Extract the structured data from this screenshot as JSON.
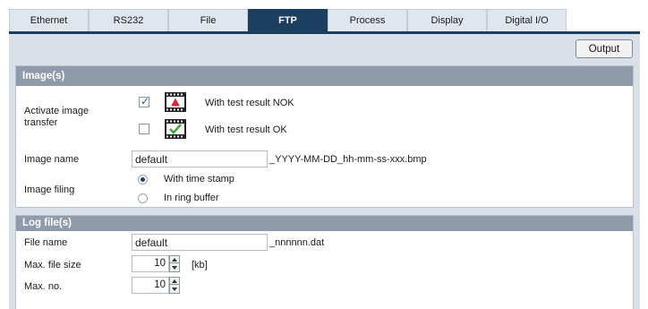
{
  "tabs": [
    {
      "label": "Ethernet",
      "active": false
    },
    {
      "label": "RS232",
      "active": false
    },
    {
      "label": "File",
      "active": false
    },
    {
      "label": "FTP",
      "active": true
    },
    {
      "label": "Process",
      "active": false
    },
    {
      "label": "Display",
      "active": false
    },
    {
      "label": "Digital I/O",
      "active": false
    }
  ],
  "output_button": "Output",
  "images": {
    "title": "Image(s)",
    "activate_label": "Activate image transfer",
    "nok": {
      "label": "With test result NOK",
      "checked": true,
      "icon": "film-warning-icon"
    },
    "ok": {
      "label": "With test result OK",
      "checked": false,
      "icon": "film-check-icon"
    },
    "name_label": "Image name",
    "name_value": "default",
    "name_suffix": "_YYYY-MM-DD_hh-mm-ss-xxx.bmp",
    "filing_label": "Image filing",
    "filing_options": [
      {
        "label": "With time stamp",
        "selected": true
      },
      {
        "label": "In ring buffer",
        "selected": false
      }
    ]
  },
  "logs": {
    "title": "Log file(s)",
    "file_label": "File name",
    "file_value": "default",
    "file_suffix": "_nnnnnn.dat",
    "size_label": "Max. file size",
    "size_value": "10",
    "size_unit": "[kb]",
    "max_label": "Max. no.",
    "max_value": "10"
  },
  "colors": {
    "tab_active": "#1d3f5f",
    "section_header": "#8f9baa",
    "panel_bg": "#d9e0e8"
  }
}
